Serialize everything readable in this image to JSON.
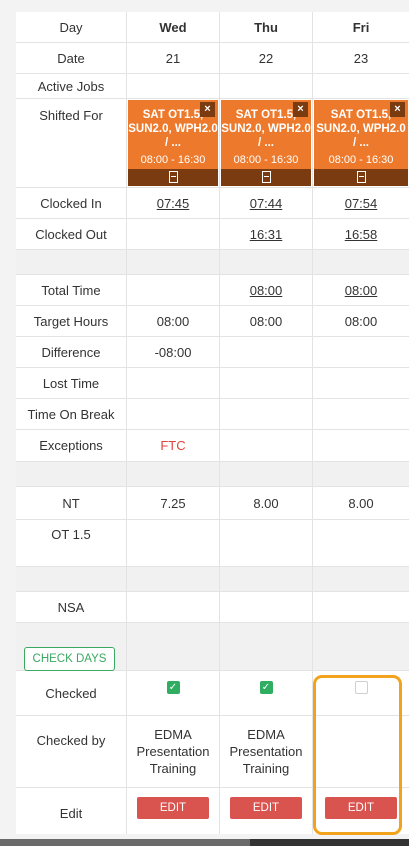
{
  "labels": {
    "day": "Day",
    "date": "Date",
    "active_jobs": "Active Jobs",
    "shifted_for": "Shifted For",
    "clocked_in": "Clocked In",
    "clocked_out": "Clocked Out",
    "total_time": "Total Time",
    "target_hours": "Target Hours",
    "difference": "Difference",
    "lost_time": "Lost Time",
    "time_on_break": "Time On Break",
    "exceptions": "Exceptions",
    "nt": "NT",
    "ot15": "OT 1.5",
    "nsa": "NSA",
    "checked": "Checked",
    "checked_by": "Checked by",
    "edit": "Edit"
  },
  "check_days_label": "CHECK DAYS",
  "days": [
    {
      "day": "Wed",
      "date": "21",
      "job": {
        "title": "SAT OT1.5, SUN2.0, WPH2.0 / ...",
        "time": "08:00 - 16:30"
      },
      "clocked_in": "07:45",
      "clocked_out": "",
      "total_time": "",
      "target_hours": "08:00",
      "difference": "-08:00",
      "lost_time": "",
      "time_on_break": "",
      "exceptions": "FTC",
      "nt": "7.25",
      "ot15": "",
      "nsa": "",
      "checked": true,
      "checked_by": "EDMA Presentation Training",
      "edit_label": "EDIT"
    },
    {
      "day": "Thu",
      "date": "22",
      "job": {
        "title": "SAT OT1.5, SUN2.0, WPH2.0 / ...",
        "time": "08:00 - 16:30"
      },
      "clocked_in": "07:44",
      "clocked_out": "16:31",
      "total_time": "08:00",
      "target_hours": "08:00",
      "difference": "",
      "lost_time": "",
      "time_on_break": "",
      "exceptions": "",
      "nt": "8.00",
      "ot15": "",
      "nsa": "",
      "checked": true,
      "checked_by": "EDMA Presentation Training",
      "edit_label": "EDIT"
    },
    {
      "day": "Fri",
      "date": "23",
      "job": {
        "title": "SAT OT1.5, SUN2.0, WPH2.0 / ...",
        "time": "08:00 - 16:30"
      },
      "clocked_in": "07:54",
      "clocked_out": "16:58",
      "total_time": "08:00",
      "target_hours": "08:00",
      "difference": "",
      "lost_time": "",
      "time_on_break": "",
      "exceptions": "",
      "nt": "8.00",
      "ot15": "",
      "nsa": "",
      "checked": false,
      "checked_by": "",
      "edit_label": "EDIT"
    }
  ],
  "icons": {
    "close": "close-icon",
    "document": "document-icon",
    "check": "checkmark-icon"
  },
  "colors": {
    "job": "#ed7a2c",
    "edit": "#d9534f",
    "checked": "#2fae62",
    "highlight": "#f2a31e"
  }
}
